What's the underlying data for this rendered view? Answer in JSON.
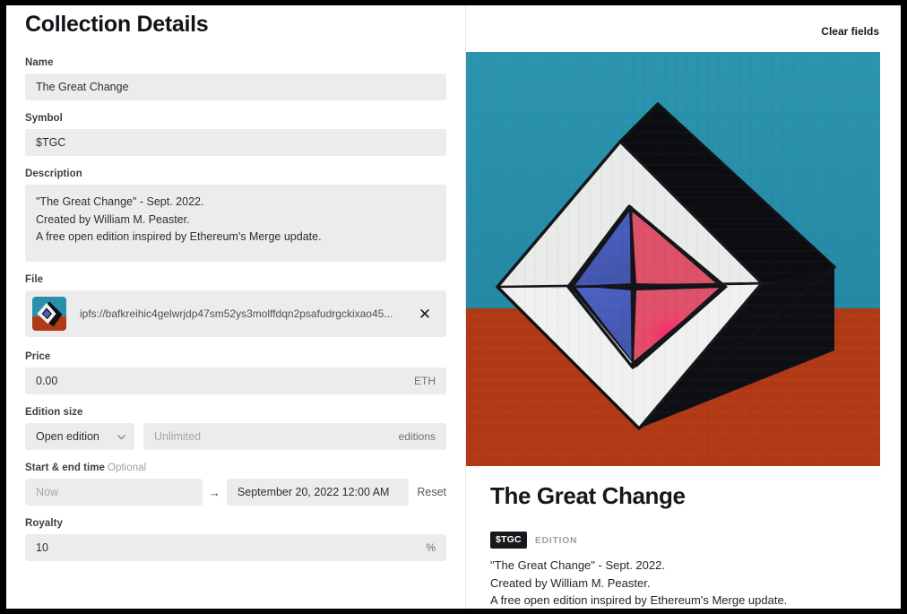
{
  "window": {
    "frame_color": "#000000",
    "background": "#ffffff"
  },
  "header": {
    "title": "Collection Details",
    "clear_fields_label": "Clear fields"
  },
  "form": {
    "name": {
      "label": "Name",
      "value": "The Great Change",
      "placeholder": ""
    },
    "symbol": {
      "label": "Symbol",
      "value": "$TGC",
      "placeholder": ""
    },
    "description": {
      "label": "Description",
      "value": "\"The Great Change\" - Sept. 2022.\nCreated by William M. Peaster.\nA free open edition inspired by Ethereum's Merge update.",
      "line1": "\"The Great Change\" - Sept. 2022.",
      "line2": "Created by William M. Peaster.",
      "line3": "A free open edition inspired by Ethereum's Merge update."
    },
    "file": {
      "label": "File",
      "value": "ipfs://bafkreihic4gelwrjdp47sm52ys3molffdqn2psafudrgckixao45...",
      "remove_icon": "✕",
      "thumbnail_icon": "artwork-thumbnail"
    },
    "price": {
      "label": "Price",
      "value": "0.00",
      "currency_suffix": "ETH"
    },
    "edition_size": {
      "label": "Edition size",
      "selected_option": "Open edition",
      "options": [
        "Open edition"
      ],
      "quantity_placeholder": "Unlimited",
      "quantity_value": "",
      "unit_suffix": "editions"
    },
    "schedule": {
      "label": "Start & end time",
      "optional_tag": "Optional",
      "start_placeholder": "Now",
      "start_value": "",
      "separator_arrow": "→",
      "end_value": "September 20, 2022 12:00 AM",
      "reset_label": "Reset"
    },
    "royalty": {
      "label": "Royalty",
      "value": "10",
      "percent_suffix": "%"
    }
  },
  "preview": {
    "title": "The Great Change",
    "symbol_badge": "$TGC",
    "edition_tag": "EDITION",
    "description_line1": "\"The Great Change\" - Sept. 2022.",
    "description_line2": "Created by William M. Peaster.",
    "description_line3": "A free open edition inspired by Ethereum's Merge update.",
    "artwork": {
      "name": "the-great-change-octahedron-painting",
      "sky_color": "#2890ab",
      "ground_color": "#b03a16",
      "facet_white": "#eef0ee",
      "facet_black": "#0d0f14",
      "facet_blue": "#4a5fc0",
      "facet_pink": "#dd5169",
      "facet_pink_hot": "#f5246f",
      "outline_color": "#111318"
    }
  }
}
